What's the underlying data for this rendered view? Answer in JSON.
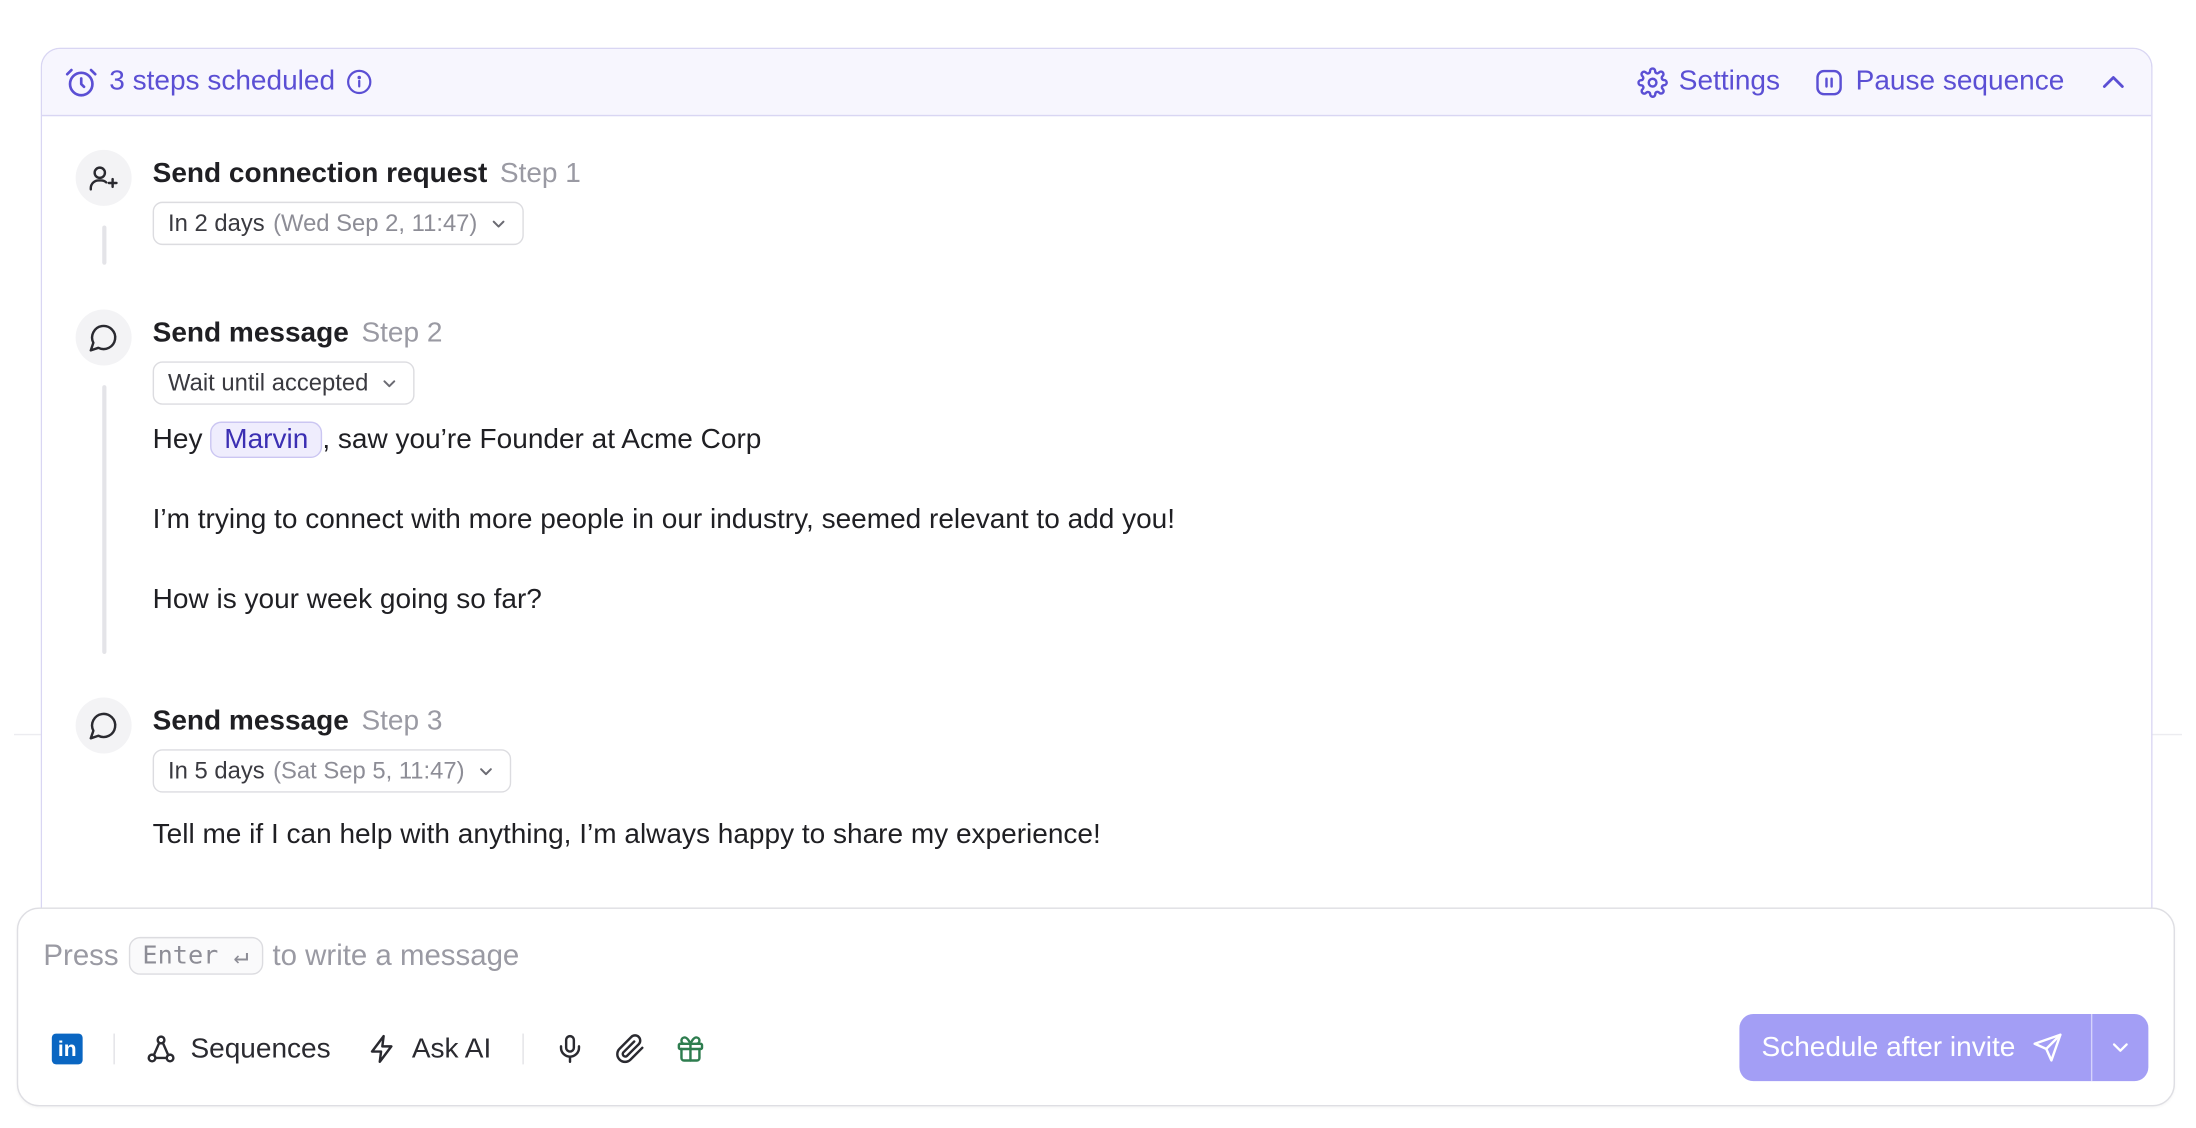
{
  "header": {
    "steps_scheduled": "3 steps scheduled",
    "settings_label": "Settings",
    "pause_label": "Pause sequence"
  },
  "steps": [
    {
      "title": "Send connection request",
      "number": "Step 1",
      "timing": "In 2 days",
      "timing_detail": "(Wed Sep 2, 11:47)",
      "icon": "user-plus-icon"
    },
    {
      "title": "Send message",
      "number": "Step 2",
      "timing": "Wait until accepted",
      "icon": "message-bubble-icon",
      "message": {
        "greeting": "Hey",
        "variable": "Marvin",
        "line1_rest": ", saw you’re Founder at Acme Corp",
        "line2": "I’m trying to connect with more people in our industry, seemed relevant to add you!",
        "line3": "How is your week going so far?"
      }
    },
    {
      "title": "Send message",
      "number": "Step 3",
      "timing": "In 5 days",
      "timing_detail": "(Sat Sep 5, 11:47)",
      "icon": "message-bubble-icon",
      "message": {
        "line1": "Tell me if I can help with anything, I’m always happy to share my experience!"
      }
    }
  ],
  "composer": {
    "press": "Press",
    "key": "Enter ↵",
    "hint": "to write a message"
  },
  "toolbar": {
    "linkedin": "in",
    "sequences": "Sequences",
    "ask_ai": "Ask AI"
  },
  "send_button": {
    "label": "Schedule after invite"
  },
  "colors": {
    "accent": "#5b4fd4",
    "button": "#a39ef5",
    "linkedin": "#0a66c2",
    "gift": "#2e7d4f"
  }
}
